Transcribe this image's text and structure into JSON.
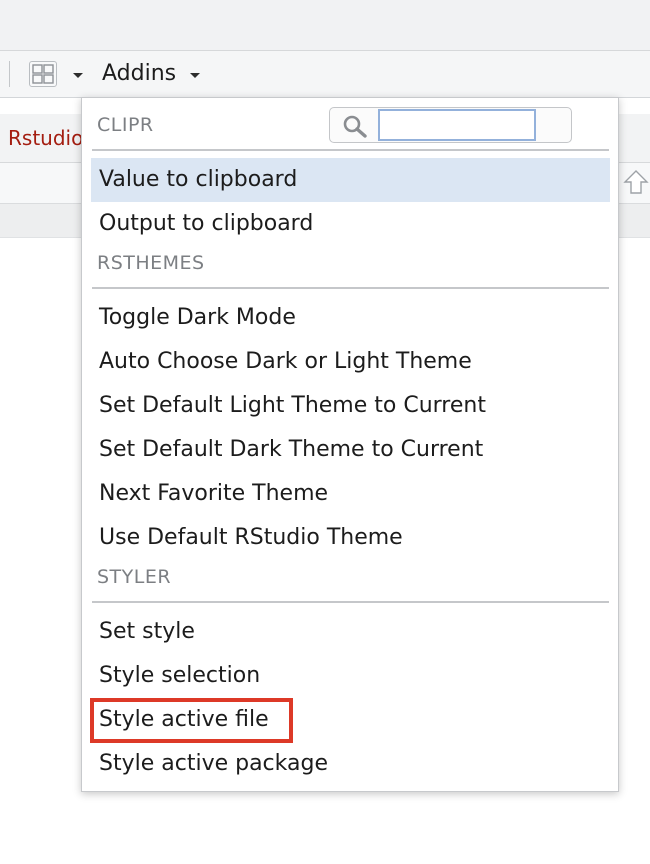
{
  "toolbar": {
    "addins_label": "Addins"
  },
  "tabbar": {
    "tab_label": "Rstudio"
  },
  "menu": {
    "search": {
      "value": "",
      "placeholder": ""
    },
    "groups": [
      {
        "header": "CLIPR",
        "items": [
          "Value to clipboard",
          "Output to clipboard"
        ]
      },
      {
        "header": "RSTHEMES",
        "items": [
          "Toggle Dark Mode",
          "Auto Choose Dark or Light Theme",
          "Set Default Light Theme to Current",
          "Set Default Dark Theme to Current",
          "Next Favorite Theme",
          "Use Default RStudio Theme"
        ]
      },
      {
        "header": "STYLER",
        "items": [
          "Set style",
          "Style selection",
          "Style active file",
          "Style active package"
        ]
      }
    ],
    "selected_item": "Value to clipboard",
    "highlighted_item": "Style active file"
  },
  "colors": {
    "selected_bg": "#dbe6f3",
    "highlight_border": "#dd3927",
    "tab_label": "#a41d10"
  }
}
